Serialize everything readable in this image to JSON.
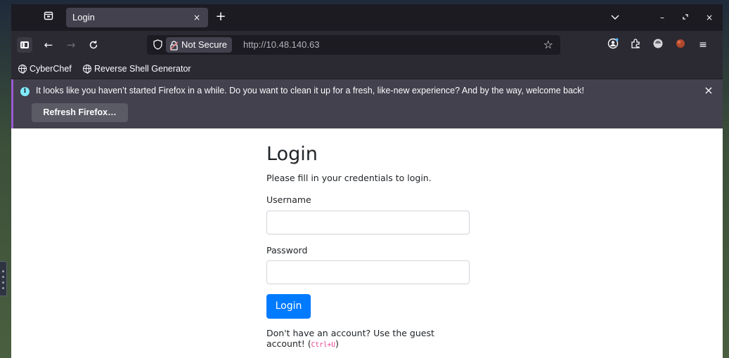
{
  "browser": {
    "tab": {
      "title": "Login",
      "close_glyph": "×"
    },
    "new_tab_glyph": "+",
    "window_controls": {
      "list": "﹀",
      "minimize": "–",
      "restore": "⤢",
      "close": "×"
    },
    "nav": {
      "back": "←",
      "forward": "→",
      "reload": "C"
    },
    "urlbar": {
      "security_label": "Not Secure",
      "url": "http://10.48.140.63",
      "star_glyph": "☆"
    },
    "toolbar_icons": [
      "account-icon",
      "extensions-icon",
      "addon-icon",
      "addon2-icon",
      "menu-icon"
    ],
    "menu_glyph": "≡",
    "bookmarks": [
      {
        "label": "CyberChef"
      },
      {
        "label": "Reverse Shell Generator"
      }
    ],
    "notification": {
      "message": "It looks like you haven’t started Firefox in a while. Do you want to clean it up for a fresh, like-new experience? And by the way, welcome back!",
      "button_label": "Refresh Firefox…",
      "close_glyph": "×",
      "info_glyph": "i"
    }
  },
  "page": {
    "title": "Login",
    "subtitle": "Please fill in your credentials to login.",
    "username_label": "Username",
    "username_value": "",
    "password_label": "Password",
    "password_value": "",
    "login_button": "Login",
    "guest_text": "Don't have an account? Use the guest account! (",
    "guest_shortcut": "Ctrl+U",
    "guest_text_end": ")"
  },
  "colors": {
    "accent": "#007bff",
    "notification_stripe": "#9b59d0",
    "info_icon": "#80ebff",
    "shortcut": "#e83e8c"
  }
}
